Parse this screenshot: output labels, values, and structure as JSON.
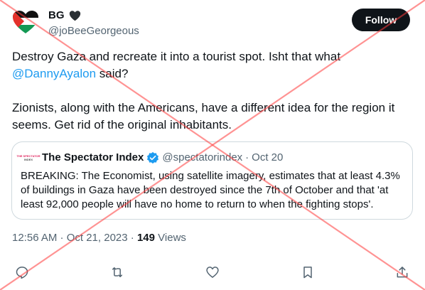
{
  "author": {
    "name": "BG",
    "handle": "@joBeeGeorgeous",
    "name_emoji": "black-heart-icon",
    "avatar": "palestine-flag-heart-icon"
  },
  "follow_button": {
    "label": "Follow",
    "background": "#0f1419"
  },
  "tweet": {
    "line1_before": "Destroy Gaza and recreate it into a tourist spot. Isht that what ",
    "mention": "@DannyAyalon",
    "line1_after": " said?",
    "paragraph2": "Zionists, along with the Americans, have a different idea for the region it seems. Get rid of the original inhabitants."
  },
  "quoted": {
    "logo_line1": "THE SPECTATOR",
    "logo_line2": "INDEX",
    "name": "The Spectator Index",
    "verified_icon": "verified-badge-icon",
    "handle": "@spectatorindex",
    "separator": "·",
    "date": "Oct 20",
    "text": "BREAKING: The Economist, using satellite imagery, estimates that at least 4.3% of buildings in Gaza have been destroyed since the 7th of October and that 'at least 92,000 people will have no home to return to when the fighting stops'."
  },
  "meta": {
    "timestamp": "12:56 AM · Oct 21, 2023",
    "separator": "·",
    "views_count": "149",
    "views_label": "Views"
  },
  "actions": [
    {
      "name": "reply-icon"
    },
    {
      "name": "retweet-icon"
    },
    {
      "name": "like-icon"
    },
    {
      "name": "bookmark-icon"
    },
    {
      "name": "share-icon"
    }
  ],
  "colors": {
    "accent": "#1d9bf0",
    "text": "#0f1419",
    "muted": "#536471",
    "border": "#cfd9de",
    "overlay_cross": "#ff3b3b"
  }
}
